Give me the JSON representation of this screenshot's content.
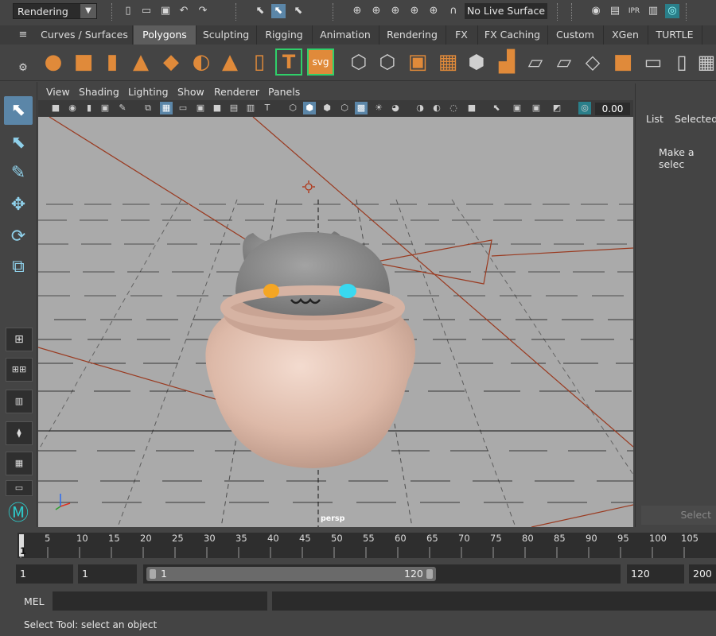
{
  "status_line": {
    "menu_set": "Rendering",
    "live_surface": "No Live Surface",
    "icons": [
      "new-scene-icon",
      "open-scene-icon",
      "save-scene-icon",
      "undo-icon",
      "redo-icon",
      "select-hierarchy-icon",
      "select-object-icon",
      "select-component-icon",
      "snap-grid-icon",
      "snap-curve-icon",
      "snap-point-icon",
      "snap-view-plane-icon",
      "snap-live-icon",
      "render-view-icon",
      "render-frame-icon",
      "ipr-render-icon",
      "render-settings-icon",
      "hypershade-icon"
    ]
  },
  "shelf": {
    "tabs": [
      "Curves / Surfaces",
      "Polygons",
      "Sculpting",
      "Rigging",
      "Animation",
      "Rendering",
      "FX",
      "FX Caching",
      "Custom",
      "XGen",
      "TURTLE"
    ],
    "active_tab": "Polygons",
    "icons": [
      "poly-sphere-icon",
      "poly-cube-icon",
      "poly-cylinder-icon",
      "poly-cone-icon",
      "poly-plane-icon",
      "poly-torus-icon",
      "poly-pyramid-icon",
      "poly-pipe-icon",
      "type-tool-icon",
      "svg-tool-icon",
      "combine-icon",
      "separate-icon",
      "smooth-icon",
      "extrude-icon",
      "bridge-icon",
      "bevel-icon",
      "insert-edge-loop-icon",
      "multi-cut-icon",
      "target-weld-icon",
      "quad-draw-icon",
      "mirror-icon",
      "uv-editor-icon",
      "bounding-box-icon",
      "pivot-icon",
      "center-pivot-icon"
    ],
    "labels": {
      "type": "T",
      "svg": "svg"
    }
  },
  "panel": {
    "menus": [
      "View",
      "Shading",
      "Lighting",
      "Show",
      "Renderer",
      "Panels"
    ],
    "exposure_value": "0.00",
    "camera_label": "persp"
  },
  "channel_box": {
    "tabs": [
      "List",
      "Selected"
    ],
    "message": "Make a selec",
    "select_button": "Select"
  },
  "time_slider": {
    "ticks": [
      "1",
      "5",
      "10",
      "15",
      "20",
      "25",
      "30",
      "35",
      "40",
      "45",
      "50",
      "55",
      "60",
      "65",
      "70",
      "75",
      "80",
      "85",
      "90",
      "95",
      "100",
      "105"
    ],
    "current_frame": "1"
  },
  "range_slider": {
    "start_time": "1",
    "playback_start": "1",
    "range_start_label": "1",
    "range_end_label": "120",
    "playback_end": "120",
    "end_time": "200"
  },
  "command_line": {
    "language": "MEL"
  },
  "help_line": {
    "text": "Select Tool: select an object"
  },
  "colors": {
    "accent": "#5b86a8",
    "shelf_orange": "#e08a3a",
    "pot": "#e2c3b4",
    "cat": "#8e8e8e",
    "eye_left": "#f5a623",
    "eye_right": "#39d9f0",
    "viewport_bg": "#aaaaaa"
  }
}
